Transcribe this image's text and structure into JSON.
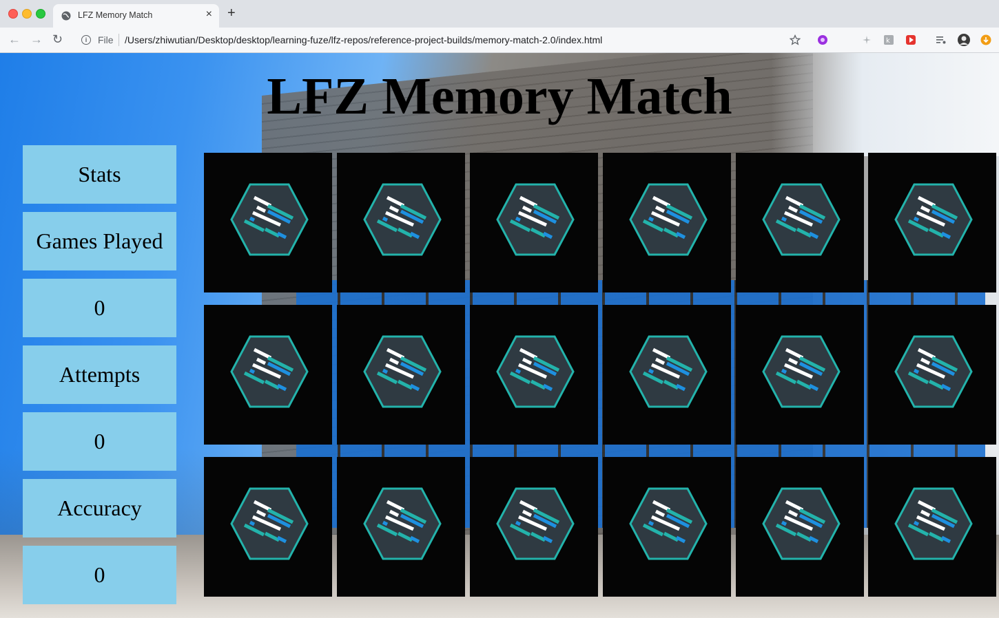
{
  "browser": {
    "tab_title": "LFZ Memory Match",
    "tab_close": "×",
    "new_tab": "+",
    "back": "←",
    "forward": "→",
    "reload": "↻",
    "address_scheme": "File",
    "address_url": "/Users/zhiwutian/Desktop/desktop/learning-fuze/lfz-repos/reference-project-builds/memory-match-2.0/index.html"
  },
  "page": {
    "title": "LFZ Memory Match"
  },
  "stats": {
    "header": "Stats",
    "games_played_label": "Games Played",
    "games_played_value": "0",
    "attempts_label": "Attempts",
    "attempts_value": "0",
    "accuracy_label": "Accuracy",
    "accuracy_value": "0"
  },
  "board": {
    "rows": 3,
    "columns": 6,
    "card_state": "face-down",
    "card_back_icon": "lfz-hexagon-logo-icon",
    "colors": {
      "card_background": "#050505",
      "hexagon_fill": "#2f3a42",
      "hexagon_stroke": "#23b3ab",
      "stripe_white": "#ffffff",
      "stripe_blue": "#1e90e0",
      "stripe_teal": "#23b3ab",
      "stat_box": "#87ceeb"
    }
  }
}
